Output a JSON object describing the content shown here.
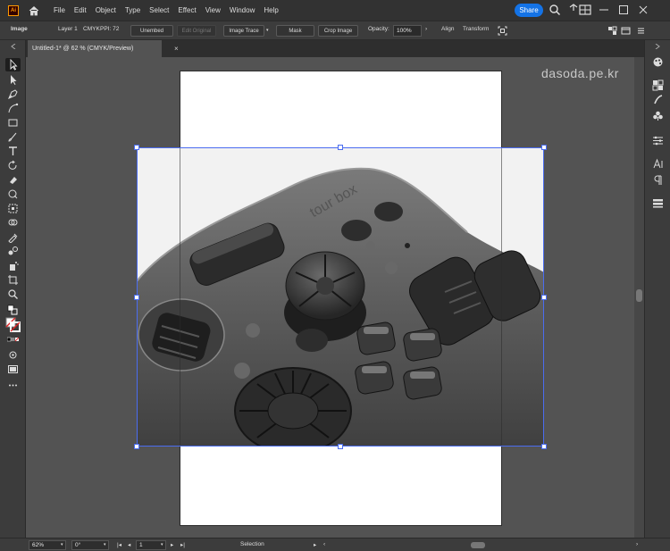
{
  "menubar": {
    "logo": "Ai",
    "menus": [
      "File",
      "Edit",
      "Object",
      "Type",
      "Select",
      "Effect",
      "View",
      "Window",
      "Help"
    ],
    "share_label": "Share"
  },
  "controlbar": {
    "context_label": "Image",
    "layer_label": "Layer 1",
    "color_mode": "CMYK",
    "ppi_label": "PPI: 72",
    "unembed_label": "Unembed",
    "edit_original_label": "Edit Original",
    "image_trace_label": "Image Trace",
    "mask_label": "Mask",
    "crop_image_label": "Crop Image",
    "opacity_label": "Opacity:",
    "opacity_value": "100%",
    "align_label": "Align",
    "transform_label": "Transform"
  },
  "document": {
    "tab_title": "Untitled-1* @ 62 % (CMYK/Preview)",
    "close_glyph": "×"
  },
  "watermark": "dasoda.pe.kr",
  "placed_image": {
    "device_brand_text": "tour box"
  },
  "statusbar": {
    "zoom_value": "62%",
    "rotation_value": "0°",
    "artboard_number": "1",
    "tool_status": "Selection"
  },
  "colors": {
    "accent": "#1473e6",
    "selection": "#4a6cf0",
    "logo_orange": "#ff9a00"
  }
}
